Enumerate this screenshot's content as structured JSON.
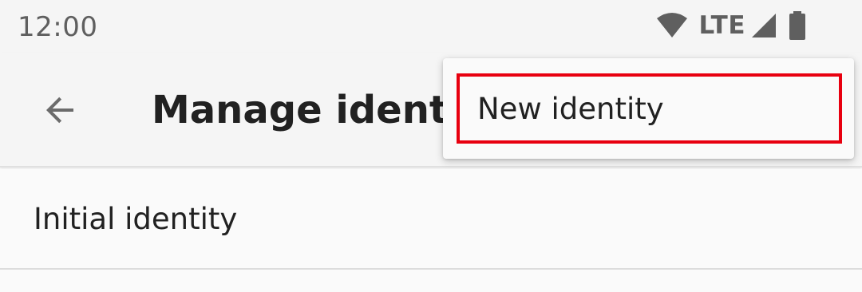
{
  "status_bar": {
    "time": "12:00",
    "network": "LTE",
    "icons": [
      "wifi-icon",
      "cell-signal-icon",
      "battery-icon"
    ]
  },
  "app_bar": {
    "back_icon": "arrow-back-icon",
    "title": "Manage identities"
  },
  "list": {
    "items": [
      {
        "label": "Initial identity"
      }
    ]
  },
  "popup_menu": {
    "items": [
      {
        "label": "New identity",
        "highlight_color": "#e8000f"
      }
    ]
  },
  "colors": {
    "bar_background": "#f5f5f5",
    "page_background": "#fafafa",
    "text_primary": "#212121",
    "status_text": "#5f5f5f",
    "highlight": "#e8000f"
  }
}
